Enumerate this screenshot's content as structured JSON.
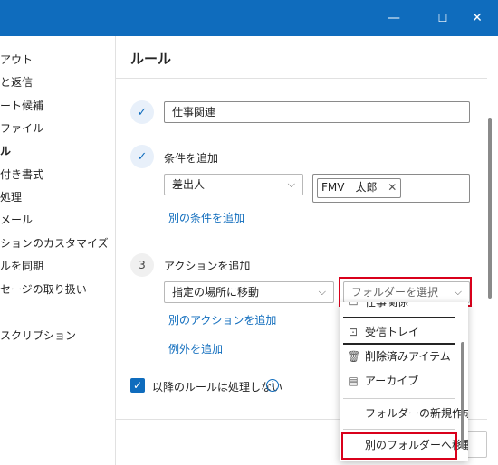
{
  "window": {
    "minimize": "—",
    "maximize": "☐",
    "close": "✕"
  },
  "sidebar": {
    "items": [
      {
        "label": "アウト",
        "active": false
      },
      {
        "label": "と返信",
        "active": false
      },
      {
        "label": "ート候補",
        "active": false
      },
      {
        "label": "ファイル",
        "active": false
      },
      {
        "label": "ル",
        "active": true
      },
      {
        "label": "付き書式",
        "active": false
      },
      {
        "label": "処理",
        "active": false
      },
      {
        "label": "メール",
        "active": false
      },
      {
        "label": "ションのカスタマイズ",
        "active": false
      },
      {
        "label": "ルを同期",
        "active": false
      },
      {
        "label": "セージの取り扱い",
        "active": false
      },
      {
        "label": "スクリプション",
        "active": false
      }
    ]
  },
  "rules": {
    "title": "ルール",
    "name_value": "仕事関連",
    "condition_heading": "条件を追加",
    "condition_select": "差出人",
    "condition_chip": "FMV　太郎",
    "add_condition_link": "別の条件を追加",
    "step3_number": "3",
    "action_heading": "アクションを追加",
    "action_select": "指定の場所に移動",
    "folder_select_placeholder": "フォルダーを選択",
    "add_action_link": "別のアクションを追加",
    "add_exception_link": "例外を追加",
    "stop_processing_label": "以降のルールは処理しない"
  },
  "folder_dropdown": {
    "items": [
      {
        "icon": "folder-icon",
        "label": "仕事関係"
      },
      {
        "icon": "inbox-icon",
        "label": "受信トレイ"
      },
      {
        "icon": "trash-icon",
        "label": "削除済みアイテム"
      },
      {
        "icon": "archive-icon",
        "label": "アーカイブ"
      },
      {
        "icon": "",
        "label": "フォルダーの新規作成"
      },
      {
        "icon": "",
        "label": "別のフォルダーへ移動..."
      }
    ]
  },
  "colors": {
    "accent": "#0f6cbd",
    "highlight": "#d9001b"
  }
}
